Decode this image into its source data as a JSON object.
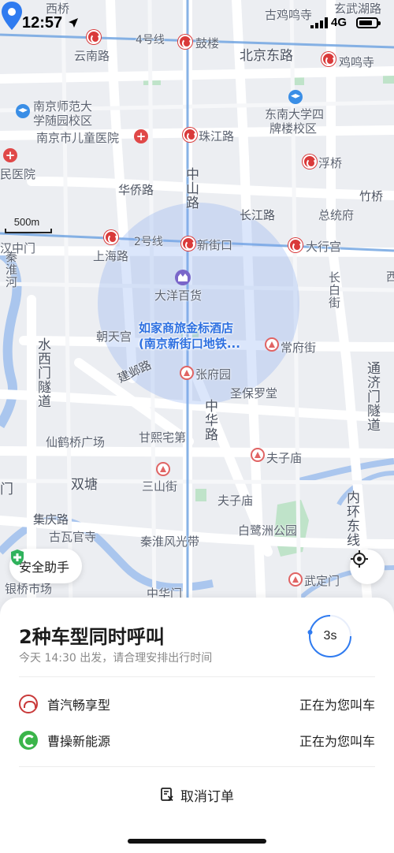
{
  "status_bar": {
    "time": "12:57",
    "network": "4G"
  },
  "map": {
    "scale_label": "500m",
    "labels": {
      "xiqiao": "西桥",
      "gujiming": "古鸡鸣寺",
      "xuanwuhu": "玄武湖路",
      "line4": "4号线",
      "gulou": "鼓楼",
      "yunnanlu": "云南路",
      "beijingdonglu": "北京东路",
      "jimingsi": "鸡鸣寺",
      "nanshida": "南京师范大",
      "nanshida2": "学随园校区",
      "dongnan": "东南大学四",
      "dongnan2": "牌楼校区",
      "ertong": "南京市儿童医院",
      "zhujianglu": "珠江路",
      "minyiyuan": "民医院",
      "fuqiao": "浮桥",
      "zhongshanlu": "中山路",
      "huaqiaolu": "华侨路",
      "zhuqiao": "竹桥",
      "changjianglu": "长江路",
      "zongtongfu": "总统府",
      "line2": "2号线",
      "xinjiekou": "新街口",
      "daxinggong": "大行宫",
      "hanzhongmen": "汉中门",
      "shanghailu": "上海路",
      "qinhuaihe": "秦淮河",
      "daiyangbaihuo": "大洋百货",
      "changbailu": "长白街",
      "xi": "西",
      "chaotiangong": "朝天宫",
      "changfujie": "常府街",
      "shuiximen": "水西门隧道",
      "jianyelu": "建邺路",
      "zhangfuyuan": "张府园",
      "tongjimen": "通济门隧道",
      "shengbaoluo": "圣保罗堂",
      "zhonghualu": "中华路",
      "xianheqiao": "仙鹤桥广场",
      "ganxi": "甘熙宅第",
      "fuzimiao_st": "夫子庙",
      "men": "门",
      "shuangtang": "双塘",
      "sanshanjie": "三山街",
      "fuzimiao": "夫子庙",
      "neihuan": "内环东线",
      "jiqinglu": "集庆路",
      "guwaguan": "古瓦官寺",
      "bailuzhou": "白鹭洲公园",
      "qinhuai_fg": "秦淮风光带",
      "wudingmen": "武定门",
      "yinqiao": "银桥市场",
      "zhonghuamen": "中华门"
    }
  },
  "pin": {
    "line1": "如家商旅金标酒店",
    "line2": "(南京新街口地铁..."
  },
  "safety": {
    "label": "安全助手"
  },
  "sheet": {
    "title": "2种车型同时呼叫",
    "subtitle": "今天 14:30 出发，请合理安排出行时间",
    "countdown": "3s",
    "cars": [
      {
        "name": "首汽畅享型",
        "status": "正在为您叫车",
        "icon": "shouqi-logo-icon",
        "color": "#c93a3a"
      },
      {
        "name": "曹操新能源",
        "status": "正在为您叫车",
        "icon": "caocao-logo-icon",
        "color": "#3bb54a"
      }
    ],
    "cancel_label": "取消订单"
  },
  "colors": {
    "accent": "#2f7bf0",
    "metro": "#d93a3a",
    "road": "#ffffff",
    "water": "#aac6ee",
    "park": "#b9e0c6",
    "radius": "#7ea6ef"
  }
}
